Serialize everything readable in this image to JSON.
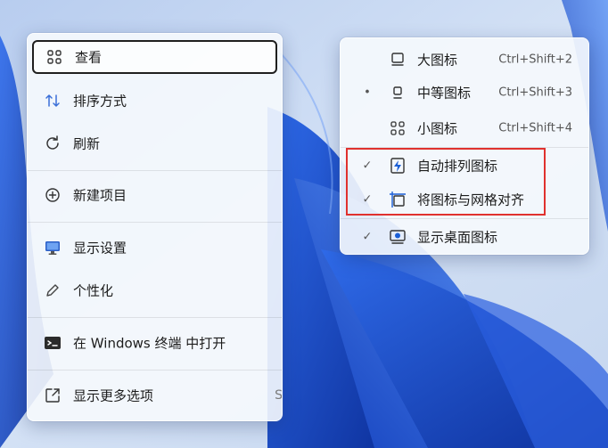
{
  "context_menu": {
    "items": [
      {
        "label": "查看",
        "icon": "grid-view-icon"
      },
      {
        "label": "排序方式",
        "icon": "sort-icon"
      },
      {
        "label": "刷新",
        "icon": "refresh-icon"
      },
      {
        "label": "新建项目",
        "icon": "add-circle-icon"
      },
      {
        "label": "显示设置",
        "icon": "display-icon"
      },
      {
        "label": "个性化",
        "icon": "pen-icon"
      },
      {
        "label": "在 Windows 终端 中打开",
        "icon": "terminal-icon"
      },
      {
        "label": "显示更多选项",
        "icon": "open-more-icon",
        "trailing": "S"
      }
    ]
  },
  "view_submenu": {
    "items": [
      {
        "label": "大图标",
        "shortcut": "Ctrl+Shift+2",
        "mark": "",
        "icon": "large-icons-icon"
      },
      {
        "label": "中等图标",
        "shortcut": "Ctrl+Shift+3",
        "mark": "•",
        "icon": "medium-icons-icon"
      },
      {
        "label": "小图标",
        "shortcut": "Ctrl+Shift+4",
        "mark": "",
        "icon": "small-icons-icon"
      },
      {
        "label": "自动排列图标",
        "shortcut": "",
        "mark": "✓",
        "icon": "auto-arrange-icon"
      },
      {
        "label": "将图标与网格对齐",
        "shortcut": "",
        "mark": "✓",
        "icon": "align-grid-icon"
      },
      {
        "label": "显示桌面图标",
        "shortcut": "",
        "mark": "✓",
        "icon": "show-desktop-icons-icon"
      }
    ]
  },
  "colors": {
    "accent": "#1a5fd6",
    "highlight_border": "#e0312e",
    "wallpaper_base": "#c9d9f2",
    "bloom_blue": "#1f57d8"
  }
}
